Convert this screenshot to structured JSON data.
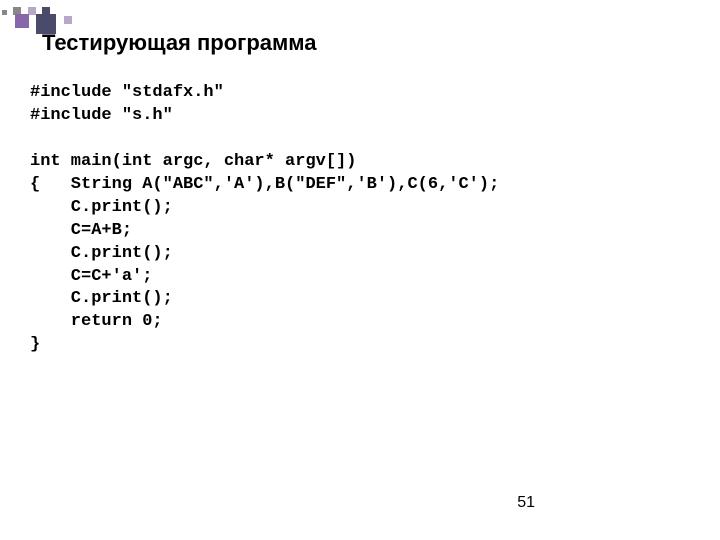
{
  "title": "Тестирующая программа",
  "code": "#include \"stdafx.h\"\n#include \"s.h\"\n\nint main(int argc, char* argv[])\n{   String A(\"ABC\",'A'),B(\"DEF\",'B'),C(6,'C');\n    C.print();\n    C=A+B;\n    C.print();\n    C=C+'a';\n    C.print();\n    return 0;\n}",
  "pageNumber": "51"
}
